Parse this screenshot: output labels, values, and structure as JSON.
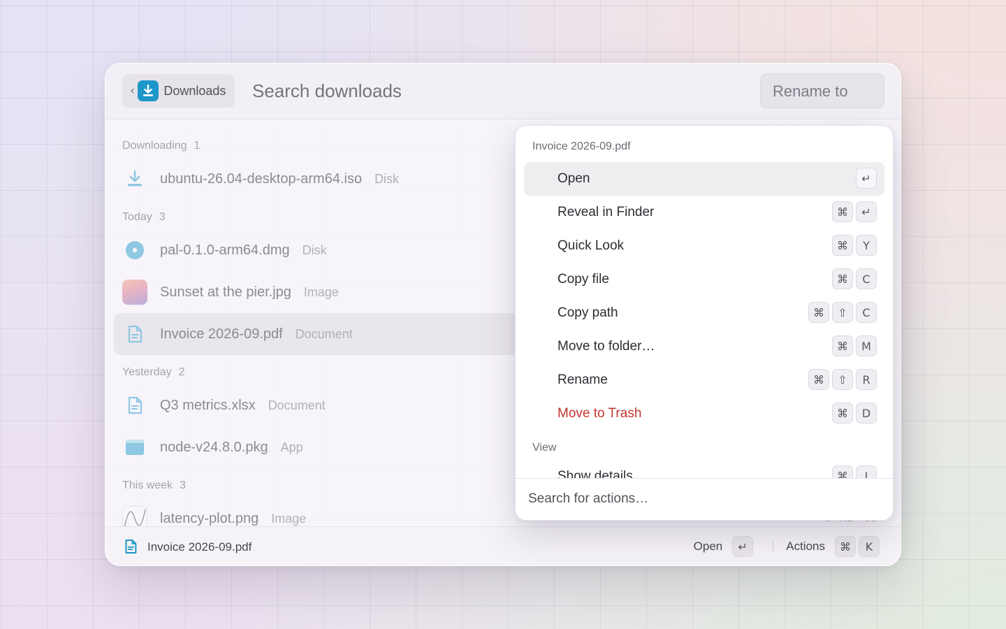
{
  "header": {
    "breadcrumb_label": "Downloads",
    "search_placeholder": "Search downloads",
    "rename_label": "Rename to"
  },
  "sections": [
    {
      "label": "Downloading",
      "count": "1"
    },
    {
      "label": "Today",
      "count": "3"
    },
    {
      "label": "Yesterday",
      "count": "2"
    },
    {
      "label": "This week",
      "count": "3"
    }
  ],
  "files": [
    {
      "name": "ubuntu-26.04-desktop-arm64.iso",
      "kind": "Disk",
      "icon": "download-arrow-icon"
    },
    {
      "name": "pal-0.1.0-arm64.dmg",
      "kind": "Disk",
      "icon": "disk-icon"
    },
    {
      "name": "Sunset at the pier.jpg",
      "kind": "Image",
      "icon": "image-thumbnail"
    },
    {
      "name": "Invoice 2026-09.pdf",
      "kind": "Document",
      "icon": "document-icon",
      "selected": true
    },
    {
      "name": "Q3 metrics.xlsx",
      "kind": "Document",
      "icon": "document-icon"
    },
    {
      "name": "node-v24.8.0.pkg",
      "kind": "App",
      "icon": "app-window-icon"
    },
    {
      "name": "latency-plot.png",
      "kind": "Image",
      "icon": "plot-thumbnail",
      "meta": "64 KB · 5d"
    }
  ],
  "action_panel": {
    "title": "Invoice 2026-09.pdf",
    "actions": [
      {
        "label": "Open",
        "keys": [
          "↵"
        ],
        "active": true
      },
      {
        "label": "Reveal in Finder",
        "keys": [
          "⌘",
          "↵"
        ]
      },
      {
        "label": "Quick Look",
        "keys": [
          "⌘",
          "Y"
        ]
      },
      {
        "label": "Copy file",
        "keys": [
          "⌘",
          "C"
        ]
      },
      {
        "label": "Copy path",
        "keys": [
          "⌘",
          "⇧",
          "C"
        ]
      },
      {
        "label": "Move to folder…",
        "keys": [
          "⌘",
          "M"
        ]
      },
      {
        "label": "Rename",
        "keys": [
          "⌘",
          "⇧",
          "R"
        ]
      },
      {
        "label": "Move to Trash",
        "keys": [
          "⌘",
          "D"
        ],
        "danger": true
      }
    ],
    "view_group_label": "View",
    "view_actions": [
      {
        "label": "Show details",
        "keys": [
          "⌘",
          "I"
        ]
      }
    ],
    "search_placeholder": "Search for actions…"
  },
  "footer": {
    "selected_name": "Invoice 2026-09.pdf",
    "open_label": "Open",
    "open_key": "↵",
    "actions_label": "Actions",
    "actions_keys": [
      "⌘",
      "K"
    ]
  },
  "colors": {
    "accent": "#1d96c9",
    "danger": "#c2352f",
    "icon_tint": "#8ec8e2"
  }
}
